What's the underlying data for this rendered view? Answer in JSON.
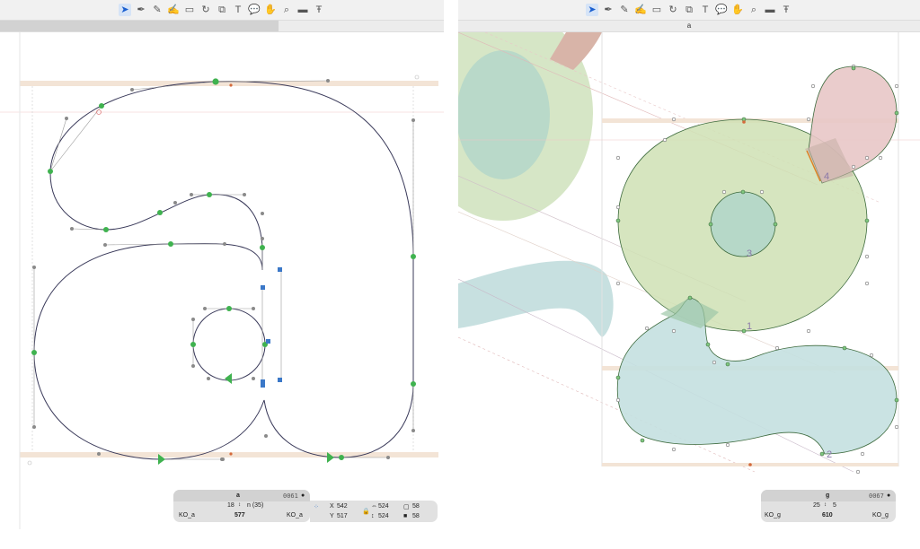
{
  "left": {
    "tab_label": "",
    "glyph_name": "a",
    "glyph_code": "0061",
    "line2_left": "18",
    "line2_right": "n (35)",
    "lsb_name": "KO_a",
    "width": "577",
    "rsb_name": "KO_a",
    "x_value": "542",
    "y_value": "517",
    "w_value": "524",
    "h_value": "524",
    "extra_top": "58",
    "extra_bottom": "58"
  },
  "right": {
    "tab_label": "a",
    "glyph_name": "g",
    "glyph_code": "0067",
    "line2_left": "25",
    "line2_right": "5",
    "lsb_name": "KO_g",
    "width": "610",
    "rsb_name": "KO_g",
    "labels": [
      "1",
      "2",
      "3",
      "4"
    ]
  },
  "colors": {
    "node_green": "#3fb24f",
    "handle_blue": "#3b78c8",
    "outline": "#3a3a5a",
    "fill_green": "#cfe0b4",
    "fill_teal": "#bfdfe0",
    "fill_pink": "#e8c7c7",
    "metric_band": "#f3e4d6"
  },
  "icons": [
    "pointer-icon",
    "pen-icon",
    "pencil-icon",
    "brush-icon",
    "rectangle-icon",
    "rotate-icon",
    "knife-icon",
    "text-icon",
    "annotation-icon",
    "hand-icon",
    "zoom-icon",
    "measure-icon",
    "type-icon"
  ]
}
